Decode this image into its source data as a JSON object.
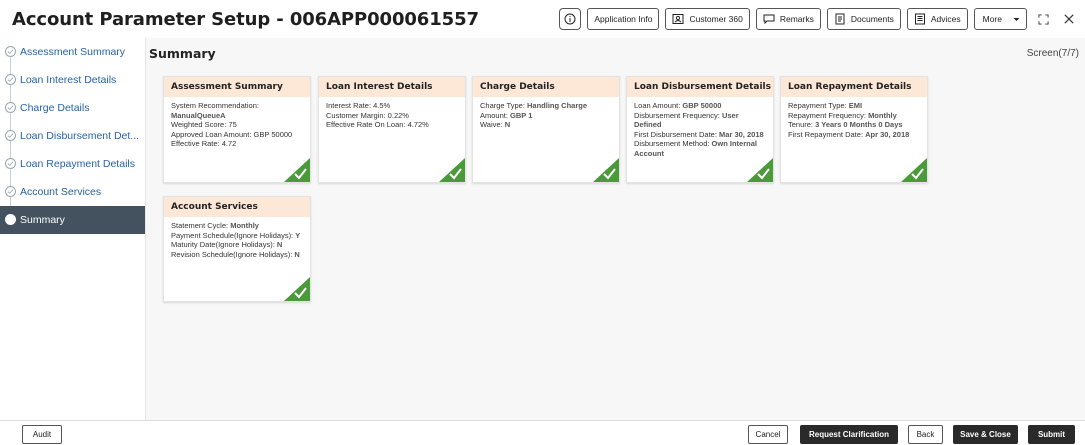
{
  "header": {
    "title": "Account Parameter Setup - 006APP000061557",
    "buttons": {
      "info_icon": "info-icon",
      "application_info": "Application Info",
      "customer360": "Customer 360",
      "remarks": "Remarks",
      "documents": "Documents",
      "advices": "Advices",
      "more": "More"
    }
  },
  "sidebar": {
    "items": [
      {
        "label": "Assessment Summary"
      },
      {
        "label": "Loan Interest Details"
      },
      {
        "label": "Charge Details"
      },
      {
        "label": "Loan Disbursement Det..."
      },
      {
        "label": "Loan Repayment Details"
      },
      {
        "label": "Account Services"
      },
      {
        "label": "Summary"
      }
    ]
  },
  "main": {
    "title": "Summary",
    "screen": "Screen(7/7)"
  },
  "cards": [
    {
      "title": "Assessment Summary",
      "rows": [
        {
          "label": "System Recommendation:",
          "value": "ManualQueueA"
        },
        {
          "label": "Weighted Score: 75",
          "value": ""
        },
        {
          "label": "Approved Loan Amount: GBP 50000",
          "value": ""
        },
        {
          "label": "Effective Rate: 4.72",
          "value": ""
        }
      ]
    },
    {
      "title": "Loan Interest Details",
      "rows": [
        {
          "label": "Interest Rate: 4.5%",
          "value": ""
        },
        {
          "label": "Customer Margin: 0.22%",
          "value": ""
        },
        {
          "label": "Effective Rate On Loan: 4.72%",
          "value": ""
        }
      ]
    },
    {
      "title": "Charge Details",
      "rows": [
        {
          "label": "Charge Type:",
          "value": "Handling Charge"
        },
        {
          "label": "Amount:",
          "value": "GBP 1"
        },
        {
          "label": "Waive:",
          "value": "N"
        }
      ]
    },
    {
      "title": "Loan Disbursement Details",
      "rows": [
        {
          "label": "Loan Amount:",
          "value": "GBP 50000"
        },
        {
          "label": "Disbursement Frequency:",
          "value": "User Defined"
        },
        {
          "label": "First Disbursement Date:",
          "value": "Mar 30, 2018"
        },
        {
          "label": "Disbursement Method:",
          "value": "Own Internal Account"
        }
      ]
    },
    {
      "title": "Loan Repayment Details",
      "rows": [
        {
          "label": "Repayment Type:",
          "value": "EMI"
        },
        {
          "label": "Repayment Frequency:",
          "value": "Monthly"
        },
        {
          "label": "Tenure:",
          "value": "3 Years 0 Months 0 Days"
        },
        {
          "label": "First Repayment Date:",
          "value": "Apr 30, 2018"
        }
      ]
    },
    {
      "title": "Account Services",
      "rows": [
        {
          "label": "Statement Cycle:",
          "value": "Monthly"
        },
        {
          "label": "Payment Schedule(Ignore Holidays):",
          "value": "Y"
        },
        {
          "label": "Maturity Date(Ignore Holidays):",
          "value": "N"
        },
        {
          "label": "Revision Schedule(Ignore Holidays):",
          "value": "N"
        }
      ]
    }
  ],
  "footer": {
    "audit": "Audit",
    "cancel": "Cancel",
    "request_clarification": "Request Clarification",
    "back": "Back",
    "save_close": "Save & Close",
    "submit": "Submit"
  },
  "colors": {
    "card_header": "#fde8d8",
    "check": "#4a9a3a",
    "active_sidebar": "#44525f",
    "link": "#2563a6"
  }
}
